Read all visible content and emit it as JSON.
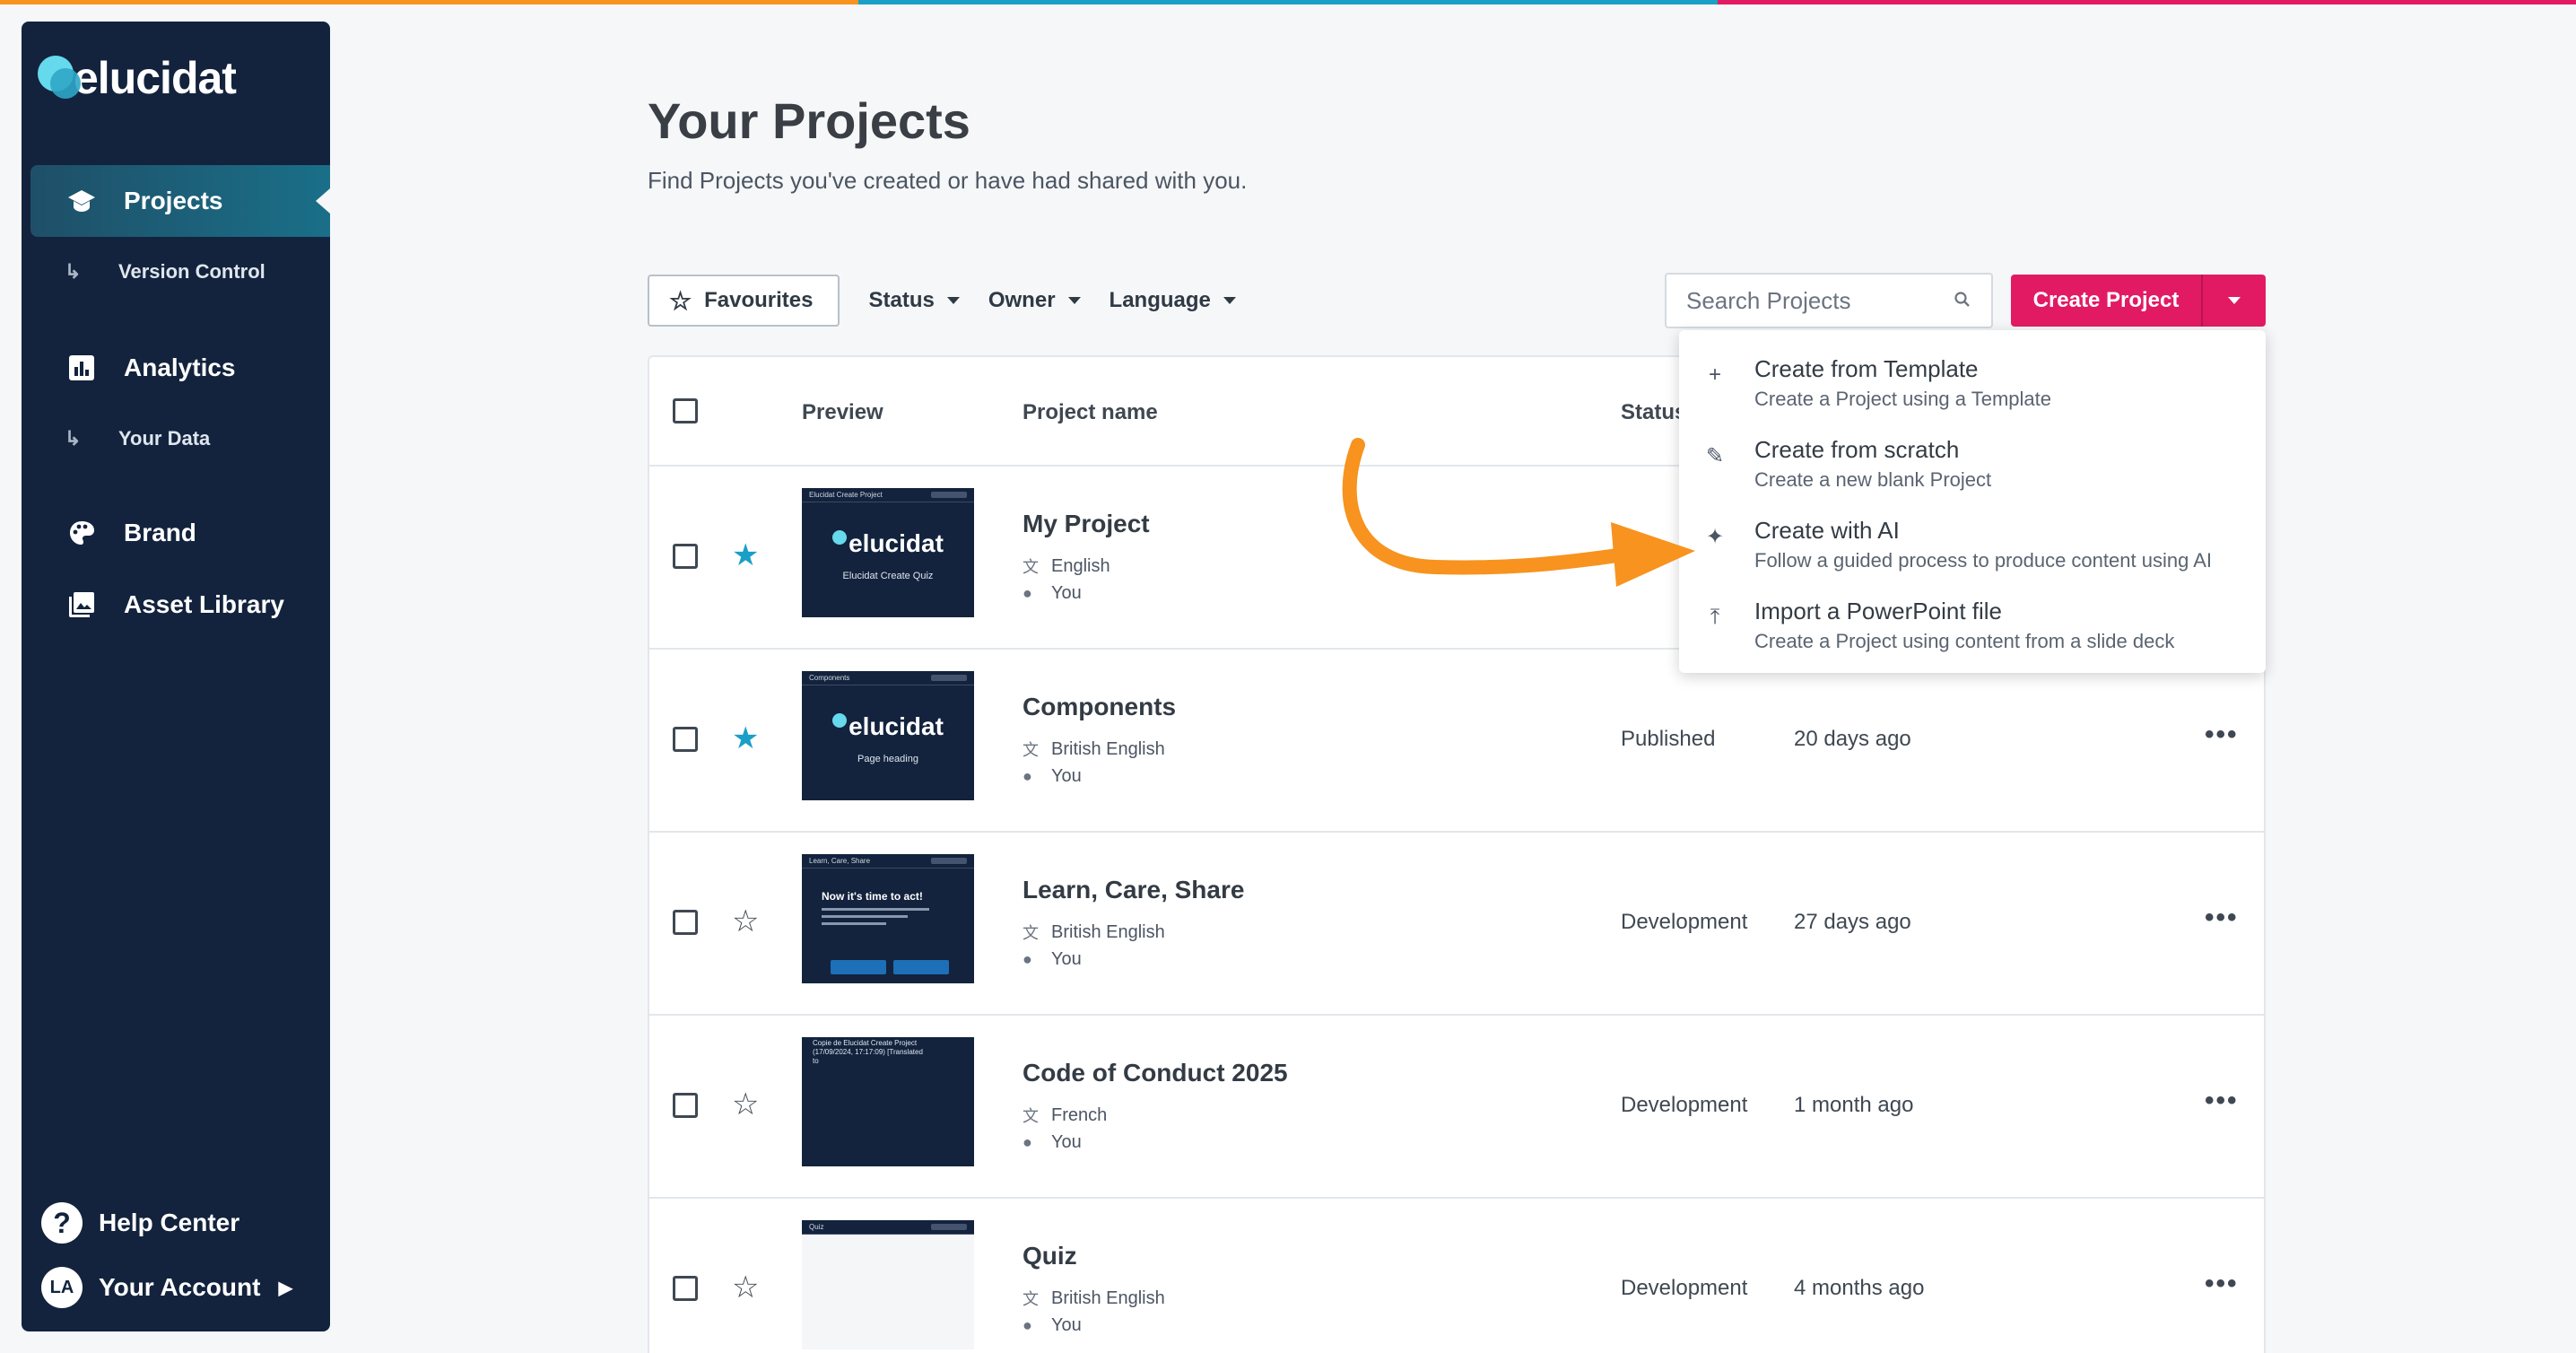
{
  "colors": {
    "accent": "#e21a64",
    "sidebar_bg": "#13233d",
    "star_filled": "#1a9fc6",
    "arrow": "#f7931e",
    "topbar": [
      "#f7931e",
      "#1a9fc6",
      "#e21a64"
    ]
  },
  "sidebar": {
    "logo_text": "elucidat",
    "items": [
      {
        "label": "Projects",
        "icon": "graduation-cap-icon",
        "active": true
      },
      {
        "label": "Version Control",
        "icon": "sub-arrow-icon"
      },
      {
        "label": "Analytics",
        "icon": "bar-chart-icon"
      },
      {
        "label": "Your Data",
        "icon": "sub-arrow-icon"
      },
      {
        "label": "Brand",
        "icon": "palette-icon"
      },
      {
        "label": "Asset Library",
        "icon": "image-library-icon"
      }
    ],
    "help_label": "Help Center",
    "account_label": "Your Account",
    "account_initials": "LA"
  },
  "page": {
    "title": "Your Projects",
    "subtitle": "Find Projects you've created or have had shared with you."
  },
  "filters": {
    "favourites": "Favourites",
    "status": "Status",
    "owner": "Owner",
    "language": "Language"
  },
  "search": {
    "placeholder": "Search Projects"
  },
  "create": {
    "label": "Create Project"
  },
  "table": {
    "headers": {
      "preview": "Preview",
      "name": "Project name",
      "status": "Status"
    },
    "rows": [
      {
        "name": "My Project",
        "language": "English",
        "owner": "You",
        "status": "",
        "date": "",
        "favourite": true,
        "thumb_title": "Elucidat Create Project",
        "thumb_sub": "Elucidat Create Quiz"
      },
      {
        "name": "Components",
        "language": "British English",
        "owner": "You",
        "status": "Published",
        "date": "20 days ago",
        "favourite": true,
        "thumb_title": "Components",
        "thumb_sub": "Page heading"
      },
      {
        "name": "Learn, Care, Share",
        "language": "British English",
        "owner": "You",
        "status": "Development",
        "date": "27 days ago",
        "favourite": false,
        "thumb_title": "Learn, Care, Share",
        "thumb_sub": "Now it's time to act!"
      },
      {
        "name": "Code of Conduct 2025",
        "language": "French",
        "owner": "You",
        "status": "Development",
        "date": "1 month ago",
        "favourite": false,
        "thumb_title": "Copie de Elucidat Create Project (17/09/2024, 17:17:09) [Translated to",
        "thumb_sub": ""
      },
      {
        "name": "Quiz",
        "language": "British English",
        "owner": "You",
        "status": "Development",
        "date": "4 months ago",
        "favourite": false,
        "thumb_title": "Quiz",
        "thumb_sub": ""
      }
    ]
  },
  "menu": {
    "items": [
      {
        "title": "Create from Template",
        "desc": "Create a Project using a Template",
        "icon": "plus-icon"
      },
      {
        "title": "Create from scratch",
        "desc": "Create a new blank Project",
        "icon": "pencil-icon"
      },
      {
        "title": "Create with AI",
        "desc": "Follow a guided process to produce content using AI",
        "icon": "sparkle-icon"
      },
      {
        "title": "Import a PowerPoint file",
        "desc": "Create a Project using content from a slide deck",
        "icon": "upload-icon"
      }
    ]
  }
}
